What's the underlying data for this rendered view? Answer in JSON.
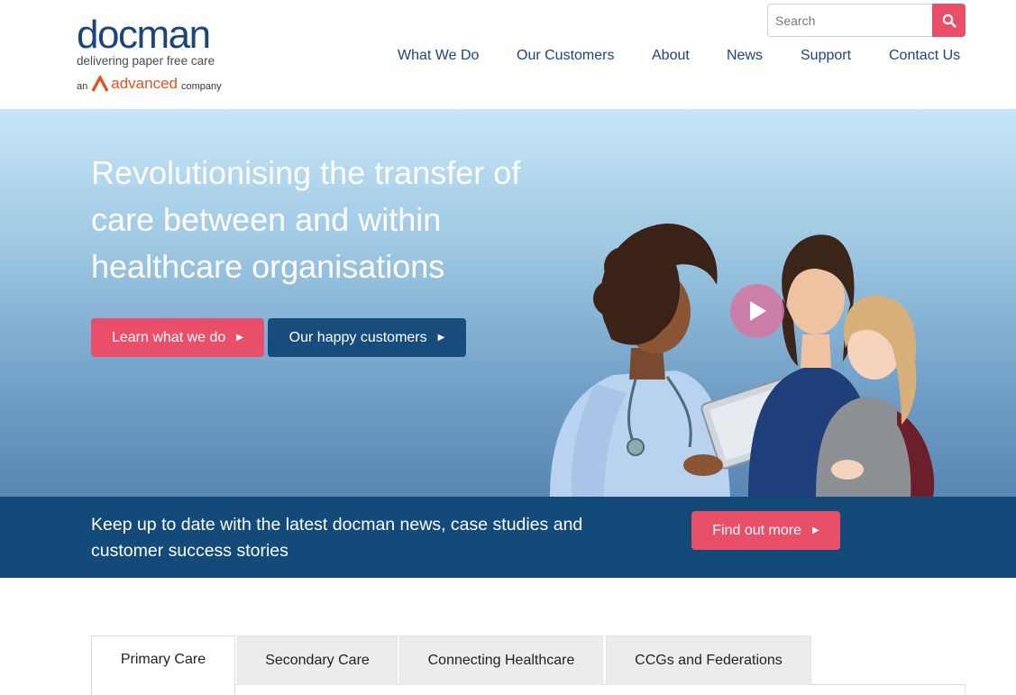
{
  "header": {
    "logo": {
      "wordmark": "docman",
      "tagline": "delivering paper free care",
      "prefix": "an",
      "brand": "advanced",
      "suffix": "company"
    },
    "search": {
      "placeholder": "Search",
      "icon": "search-icon"
    },
    "nav": [
      {
        "label": "What We Do"
      },
      {
        "label": "Our Customers"
      },
      {
        "label": "About"
      },
      {
        "label": "News"
      },
      {
        "label": "Support"
      },
      {
        "label": "Contact Us"
      }
    ]
  },
  "hero": {
    "title": "Revolutionising the transfer of care between and within healthcare organisations",
    "primary_button": "Learn what we do",
    "secondary_button": "Our happy customers",
    "play_icon": "play-icon"
  },
  "band": {
    "text": "Keep up to date with the latest docman news, case studies and customer success stories",
    "button": "Find out more"
  },
  "tabs": [
    {
      "label": "Primary Care",
      "active": true
    },
    {
      "label": "Secondary Care",
      "active": false
    },
    {
      "label": "Connecting Healthcare",
      "active": false
    },
    {
      "label": "CCGs and Federations",
      "active": false
    }
  ],
  "colors": {
    "navy": "#1d4577",
    "pink": "#e94f69",
    "band": "#134a7a",
    "accent_orange": "#e2531d"
  }
}
